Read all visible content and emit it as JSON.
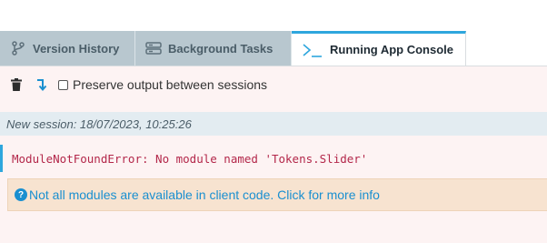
{
  "tabs": [
    {
      "label": "Version History",
      "icon": "branch-icon",
      "active": false
    },
    {
      "label": "Background Tasks",
      "icon": "tasks-icon",
      "active": false
    },
    {
      "label": "Running App Console",
      "icon": "terminal-icon",
      "active": true
    }
  ],
  "toolbar": {
    "clear_icon": "trash-icon",
    "scroll_icon": "arrow-wrap-icon",
    "preserve_label": "Preserve output between sessions",
    "preserve_checked": false
  },
  "console": {
    "session_text": "New session: 18/07/2023, 10:25:26",
    "error_text": "ModuleNotFoundError: No module named 'Tokens.Slider'",
    "info_icon": "?",
    "info_text": "Not all modules are available in client code. Click for more info"
  },
  "colors": {
    "accent": "#2ea6dd",
    "error": "#b3274a",
    "info_bg": "#f7e3d0",
    "link": "#1a8fd0",
    "tab_inactive_bg": "#b8c7cf"
  }
}
